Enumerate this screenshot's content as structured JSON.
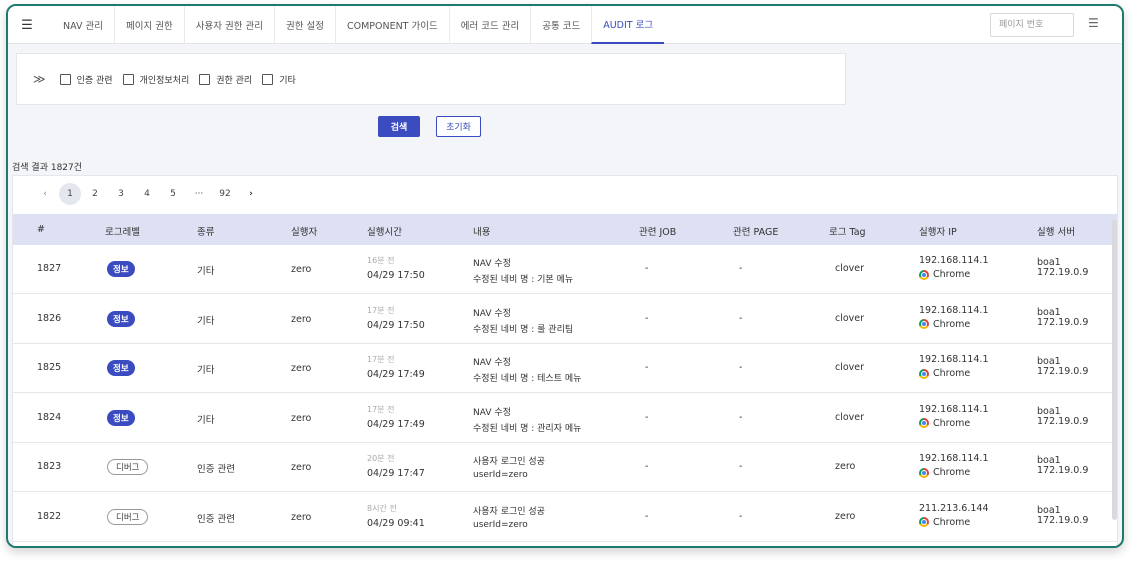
{
  "tabs": [
    {
      "label": "NAV 관리"
    },
    {
      "label": "페이지 권한"
    },
    {
      "label": "사용자 권한 관리"
    },
    {
      "label": "권한 설정"
    },
    {
      "label": "COMPONENT 가이드"
    },
    {
      "label": "에러 코드 관리"
    },
    {
      "label": "공통 코드"
    },
    {
      "label": "AUDIT 로그"
    }
  ],
  "active_tab": "AUDIT 로그",
  "page_number_placeholder": "페이지 번호",
  "filters": [
    {
      "label": "인증 관련",
      "checked": false
    },
    {
      "label": "개인정보처리",
      "checked": false
    },
    {
      "label": "권한 관리",
      "checked": false
    },
    {
      "label": "기타",
      "checked": false
    }
  ],
  "buttons": {
    "search": "검색",
    "reset": "초기화"
  },
  "result_count": "검색 결과 1827건",
  "pagination": {
    "prev": "‹",
    "pages": [
      "1",
      "2",
      "3",
      "4",
      "5"
    ],
    "ellipsis": "···",
    "last": "92",
    "next": "›",
    "current": "1"
  },
  "columns": [
    "#",
    "로그레벨",
    "종류",
    "실행자",
    "실행시간",
    "내용",
    "관련 JOB",
    "관련 PAGE",
    "로그 Tag",
    "실행자 IP",
    "실행 서버"
  ],
  "rows": [
    {
      "id": "1827",
      "level": "정보",
      "level_type": "info",
      "kind": "기타",
      "actor": "zero",
      "ago": "16분 전",
      "time": "04/29 17:50",
      "content_title": "NAV 수정",
      "content_sub": "수정된 네비 명 : 기본 메뉴",
      "job": "-",
      "page": "-",
      "tag": "clover",
      "ip": "192.168.114.1",
      "browser": "Chrome",
      "server_name": "boa1",
      "server_ip": "172.19.0.9"
    },
    {
      "id": "1826",
      "level": "정보",
      "level_type": "info",
      "kind": "기타",
      "actor": "zero",
      "ago": "17분 전",
      "time": "04/29 17:50",
      "content_title": "NAV 수정",
      "content_sub": "수정된 네비 명 : 룰 관리팀",
      "job": "-",
      "page": "-",
      "tag": "clover",
      "ip": "192.168.114.1",
      "browser": "Chrome",
      "server_name": "boa1",
      "server_ip": "172.19.0.9"
    },
    {
      "id": "1825",
      "level": "정보",
      "level_type": "info",
      "kind": "기타",
      "actor": "zero",
      "ago": "17분 전",
      "time": "04/29 17:49",
      "content_title": "NAV 수정",
      "content_sub": "수정된 네비 명 : 테스트 메뉴",
      "job": "-",
      "page": "-",
      "tag": "clover",
      "ip": "192.168.114.1",
      "browser": "Chrome",
      "server_name": "boa1",
      "server_ip": "172.19.0.9"
    },
    {
      "id": "1824",
      "level": "정보",
      "level_type": "info",
      "kind": "기타",
      "actor": "zero",
      "ago": "17분 전",
      "time": "04/29 17:49",
      "content_title": "NAV 수정",
      "content_sub": "수정된 네비 명 : 관리자 메뉴",
      "job": "-",
      "page": "-",
      "tag": "clover",
      "ip": "192.168.114.1",
      "browser": "Chrome",
      "server_name": "boa1",
      "server_ip": "172.19.0.9"
    },
    {
      "id": "1823",
      "level": "디버그",
      "level_type": "debug",
      "kind": "인증 관련",
      "actor": "zero",
      "ago": "20분 전",
      "time": "04/29 17:47",
      "content_title": "사용자 로그인 성공",
      "content_sub": "userId=zero",
      "job": "-",
      "page": "-",
      "tag": "zero",
      "ip": "192.168.114.1",
      "browser": "Chrome",
      "server_name": "boa1",
      "server_ip": "172.19.0.9"
    },
    {
      "id": "1822",
      "level": "디버그",
      "level_type": "debug",
      "kind": "인증 관련",
      "actor": "zero",
      "ago": "8시간 전",
      "time": "04/29 09:41",
      "content_title": "사용자 로그인 성공",
      "content_sub": "userId=zero",
      "job": "-",
      "page": "-",
      "tag": "zero",
      "ip": "211.213.6.144",
      "browser": "Chrome",
      "server_name": "boa1",
      "server_ip": "172.19.0.9"
    }
  ],
  "colors": {
    "accent": "#3a4cbf",
    "frame": "#1e7a6a",
    "header_bg": "#dde1f3"
  }
}
